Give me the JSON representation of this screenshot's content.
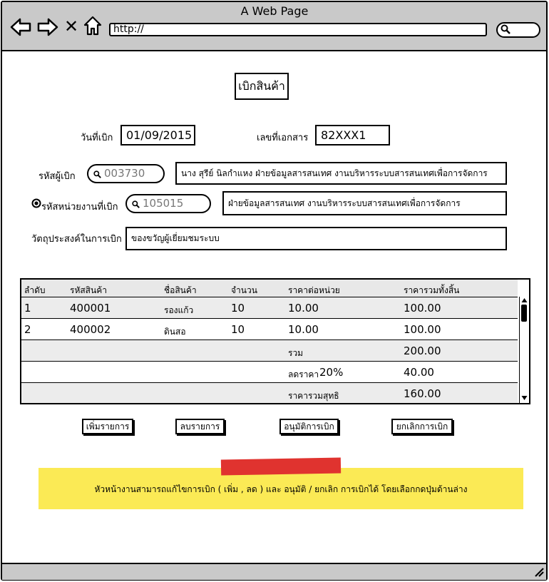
{
  "window": {
    "title": "A Web Page",
    "url": "http://"
  },
  "form": {
    "title": "เบิกสินค้า",
    "date_label": "วันที่เบิก",
    "date_value": "01/09/2015",
    "docno_label": "เลขที่เอกสาร",
    "docno_value": "82XXX1",
    "requester_label": "รหัสผู้เบิก",
    "requester_code": "003730",
    "requester_detail": "นาง สุรีย์ นิลกำแหง ฝ่ายข้อมูลสารสนเทศ งานบริหารระบบสารสนเทศเพื่อการจัดการ",
    "unit_label": "รหัสหน่วยงานที่เบิก",
    "unit_code": "105015",
    "unit_detail": "ฝ่ายข้อมูลสารสนเทศ งานบริหารระบบสารสนเทศเพื่อการจัดการ",
    "purpose_label": "วัตถุประสงค์ในการเบิก",
    "purpose_value": "ของขวัญผู้เยี่ยมชมระบบ"
  },
  "table": {
    "headers": [
      "ลำดับ",
      "รหัสสินค้า",
      "ชื่อสินค้า",
      "จำนวน",
      "ราคาต่อหน่วย",
      "ราคารวมทั้งสิ้น"
    ],
    "rows": [
      {
        "no": "1",
        "code": "400001",
        "name": "รองแก้ว",
        "qty": "10",
        "unit_price": "10.00",
        "total": "100.00"
      },
      {
        "no": "2",
        "code": "400002",
        "name": "ดินสอ",
        "qty": "10",
        "unit_price": "10.00",
        "total": "100.00"
      }
    ],
    "summary": {
      "sum_label": "รวม",
      "sum_value": "200.00",
      "discount_label": "ลดราคา",
      "discount_percent": "20%",
      "discount_value": "40.00",
      "net_label": "ราคารวมสุทธิ",
      "net_value": "160.00"
    }
  },
  "buttons": {
    "add": "เพิ่มรายการ",
    "delete": "ลบรายการ",
    "approve": "อนุมัติการเบิก",
    "cancel": "ยกเลิกการเบิก"
  },
  "note": {
    "text": "หัวหน้างานสามารถแก้ไขการเบิก ( เพิ่ม , ลด ) และ อนุมัติ / ยกเลิก การเบิกได้ โดยเลือกกดปุ่มด้านล่าง",
    "tape_color": "#e0332f",
    "paper_color": "#fbea55"
  },
  "icons": [
    "back-arrow-icon",
    "forward-arrow-icon",
    "close-icon",
    "home-icon",
    "search-icon",
    "radio-selected-icon",
    "scroll-up-icon",
    "scroll-down-icon",
    "resize-grip-icon"
  ]
}
